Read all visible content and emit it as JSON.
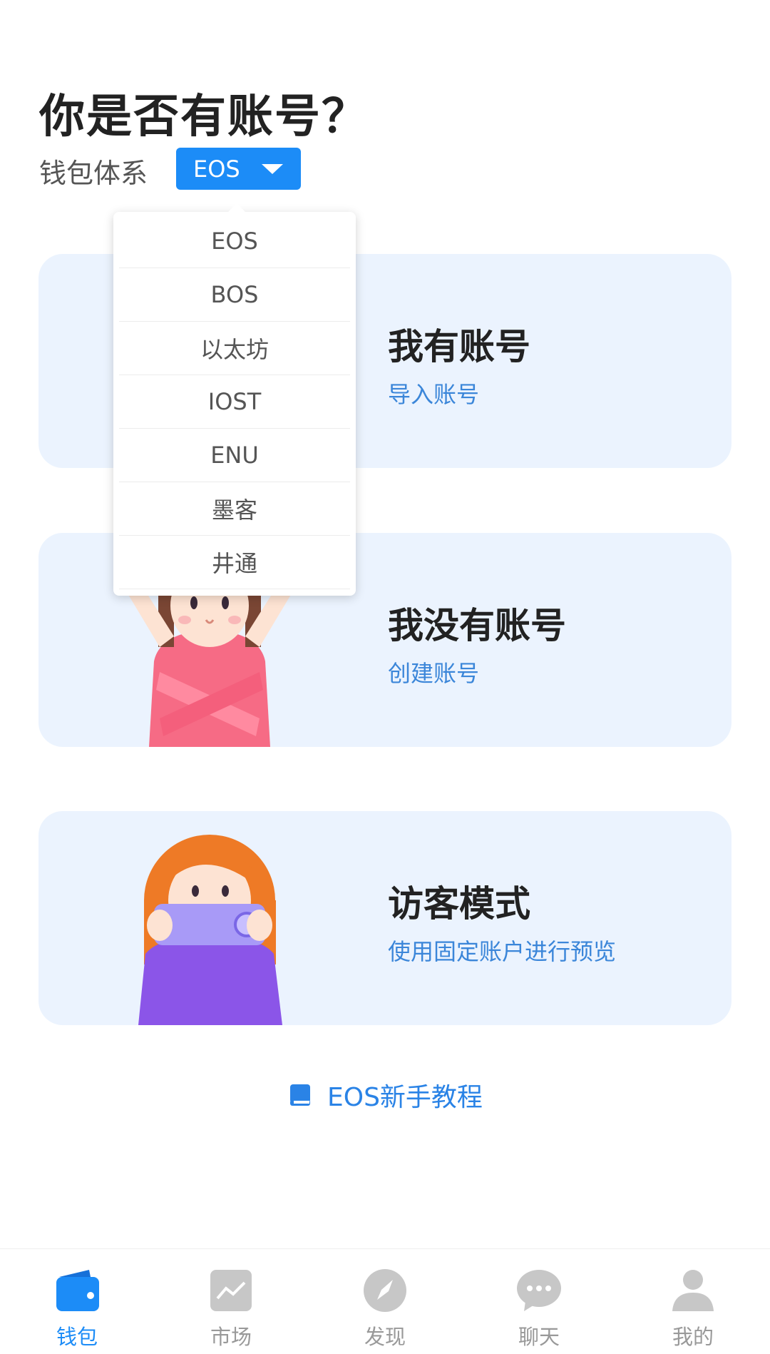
{
  "header": {
    "title": "你是否有账号？",
    "wallet_system_label": "钱包体系",
    "selected_chain": "EOS"
  },
  "dropdown": {
    "options": [
      "EOS",
      "BOS",
      "以太坊",
      "IOST",
      "ENU",
      "墨客",
      "井通"
    ]
  },
  "cards": [
    {
      "title": "我有账号",
      "subtitle": "导入账号"
    },
    {
      "title": "我没有账号",
      "subtitle": "创建账号"
    },
    {
      "title": "访客模式",
      "subtitle": "使用固定账户进行预览"
    }
  ],
  "tutorial": {
    "label": "EOS新手教程"
  },
  "tabbar": {
    "tabs": [
      {
        "label": "钱包",
        "icon": "wallet-icon",
        "active": true
      },
      {
        "label": "市场",
        "icon": "market-chart-icon",
        "active": false
      },
      {
        "label": "发现",
        "icon": "compass-icon",
        "active": false
      },
      {
        "label": "聊天",
        "icon": "chat-bubble-icon",
        "active": false
      },
      {
        "label": "我的",
        "icon": "person-icon",
        "active": false
      }
    ]
  },
  "colors": {
    "accent": "#1c8cf7",
    "link": "#3b86d9",
    "card_bg": "#ebf3fe",
    "inactive_tab": "#c7c7c7"
  }
}
